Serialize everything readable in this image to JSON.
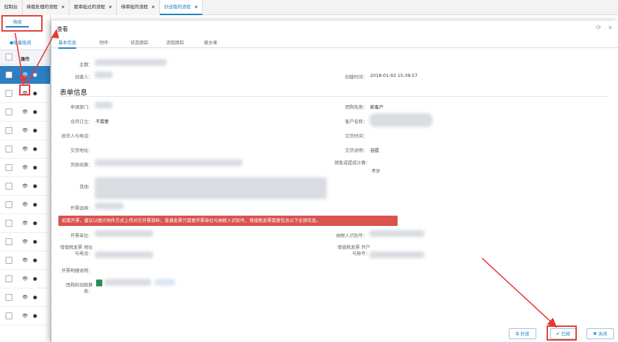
{
  "tabs": [
    {
      "label": "控制台",
      "closable": false
    },
    {
      "label": "待我处理的流程",
      "closable": true
    },
    {
      "label": "我审批过的流程",
      "closable": true
    },
    {
      "label": "待审批的流程",
      "closable": true
    },
    {
      "label": "抄送我的流程",
      "closable": true,
      "active": true
    }
  ],
  "left": {
    "subtab": "待阅",
    "batch_label": "批量批阅",
    "op_header": "操作"
  },
  "modal": {
    "title": "查看",
    "tabs": [
      "基本信息",
      "附件",
      "状态跟踪",
      "流程跟踪",
      "督办录"
    ],
    "fields": {
      "subject_label": "主题：",
      "creator_label": "创建人：",
      "created_time_label": "创建时间：",
      "created_time": "2018-01-02 15:39:57",
      "section_title": "表单信息",
      "dept_label": "申请部门：",
      "purchase_type_label": "团购性质：",
      "purchase_type": "新客户",
      "contract_label": "合同订立：",
      "contract": "不需要",
      "customer_label": "客户名称：",
      "receiver_label": "收货人与电话：",
      "delivery_time_label": "交货时间：",
      "delivery_addr_label": "交货地址：",
      "delivery_note_label": "交货说明：",
      "delivery_note": "自提",
      "payment_label": "货款结算：",
      "sales_label": "销售或提成计算：",
      "sales": "不计",
      "other_label": "其他",
      "invoice_label": "开票选择：",
      "alert": "如需开票，建议以图片附件方式上传对方开票资料；普通发票只需要开票单位与纳税人识别号，增值税发票需要包含以下全部信息。",
      "invoice_unit_label": "开票单位：",
      "taxpayer_label": "纳税人识别号：",
      "vat_addr_label": "增值税发票 地址与电话：",
      "vat_bank_label": "增值税发票 开户与账号：",
      "invoice_desc_label": "开票明细说明：",
      "attach_label": "团购利润核算表："
    },
    "buttons": {
      "cc": "抄送",
      "read": "已阅",
      "close": "关闭"
    }
  },
  "colors": {
    "accent": "#1a7fc2",
    "alert": "#d9534f",
    "highlight": "#e53935",
    "selected_row": "#2d7ec4"
  },
  "icons": [
    "eye-icon",
    "comment-icon",
    "refresh-icon",
    "close-icon",
    "copy-icon",
    "check-icon"
  ]
}
